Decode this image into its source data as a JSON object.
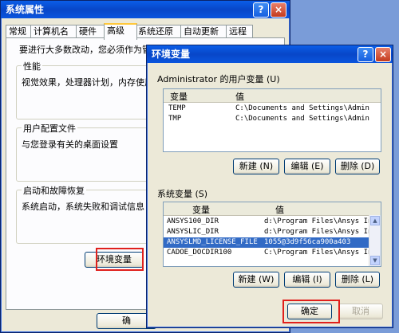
{
  "sysprops": {
    "title": "系统属性",
    "help_btn": "?",
    "close_btn": "×",
    "tabs": [
      "常规",
      "计算机名",
      "硬件",
      "高级",
      "系统还原",
      "自动更新",
      "远程"
    ],
    "intro": "要进行大多数改动，您必须作为管理",
    "performance": {
      "label": "性能",
      "desc": "视觉效果，处理器计划，内存使用"
    },
    "profiles": {
      "label": "用户配置文件",
      "desc": "与您登录有关的桌面设置"
    },
    "startup": {
      "label": "启动和故障恢复",
      "desc": "系统启动，系统失败和调试信息"
    },
    "env_button": "环境变量",
    "ok_button": "确"
  },
  "envvars": {
    "title": "环境变量",
    "help_btn": "?",
    "close_btn": "×",
    "user_group": "Administrator 的用户变量 (U)",
    "col_var": "变量",
    "col_val": "值",
    "user_vars": [
      {
        "name": "TEMP",
        "value": "C:\\Documents and Settings\\Admin..."
      },
      {
        "name": "TMP",
        "value": "C:\\Documents and Settings\\Admin..."
      }
    ],
    "user_buttons": {
      "new": "新建 (N)",
      "edit": "编辑 (E)",
      "delete": "删除 (D)"
    },
    "sys_group": "系统变量 (S)",
    "sys_vars": [
      {
        "name": "ANSYS100_DIR",
        "value": "d:\\Program Files\\Ansys Inc\\v"
      },
      {
        "name": "ANSYSLIC_DIR",
        "value": "d:\\Program Files\\Ansys Inc\\v"
      },
      {
        "name": "ANSYSLMD_LICENSE_FILE",
        "value": "1055@3d9f56ca900a403"
      },
      {
        "name": "CADOE_DOCDIR100",
        "value": "C:\\Program Files\\Ansys Inc\\v"
      }
    ],
    "sys_buttons": {
      "new": "新建 (W)",
      "edit": "编辑 (I)",
      "delete": "删除 (L)"
    },
    "ok_button": "确定",
    "cancel_button": "取消"
  }
}
